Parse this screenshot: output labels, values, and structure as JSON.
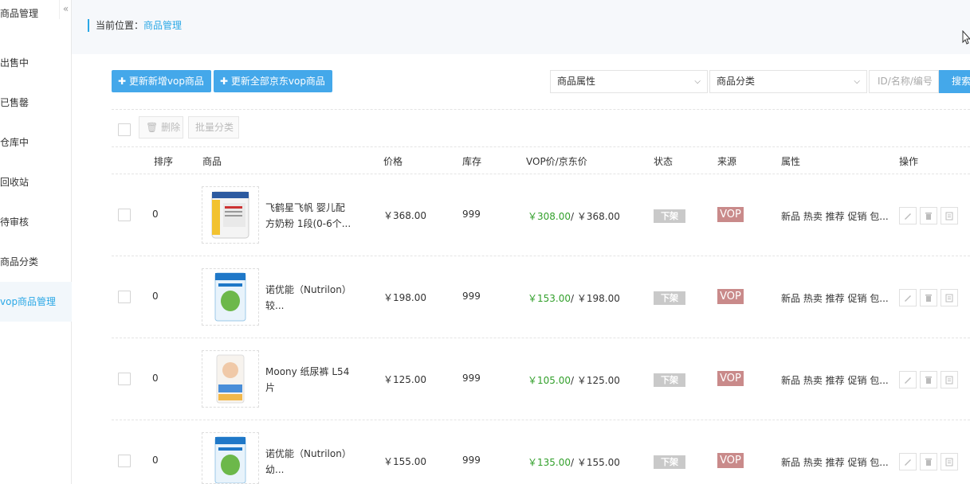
{
  "sidebar": {
    "title": "商品管理",
    "collapse_glyph": "«",
    "items": [
      {
        "label": "出售中"
      },
      {
        "label": "已售罄"
      },
      {
        "label": "仓库中"
      },
      {
        "label": "回收站"
      },
      {
        "label": "待审核"
      },
      {
        "label": "商品分类"
      },
      {
        "label": "vop商品管理"
      }
    ]
  },
  "breadcrumb": {
    "prefix": "当前位置：",
    "current": "商品管理"
  },
  "toolbar": {
    "btn_update_new": "✚ 更新新增vop商品",
    "btn_update_all": "✚ 更新全部京东vop商品",
    "filter_attr": "商品属性",
    "filter_category": "商品分类",
    "search_placeholder": "ID/名称/编号",
    "search_label": "搜索"
  },
  "bulk": {
    "delete_label": "删除",
    "batch_category_label": "批量分类"
  },
  "table": {
    "headers": [
      "排序",
      "商品",
      "价格",
      "库存",
      "VOP价/京东价",
      "状态",
      "来源",
      "属性",
      "操作"
    ],
    "rows": [
      {
        "sort": "0",
        "name": "飞鹤星飞帆 婴儿配方奶粉 1段(0-6个...",
        "price": "￥368.00",
        "stock": "999",
        "vop": "￥308.00",
        "jd": "/ ￥368.00",
        "status": "下架",
        "source": "VOP",
        "attrs": "新品 热卖 推荐 促销 包..."
      },
      {
        "sort": "0",
        "name": "诺优能（Nutrilon）较...",
        "price": "￥198.00",
        "stock": "999",
        "vop": "￥153.00",
        "jd": "/ ￥198.00",
        "status": "下架",
        "source": "VOP",
        "attrs": "新品 热卖 推荐 促销 包..."
      },
      {
        "sort": "0",
        "name": "Moony 纸尿裤 L54片",
        "price": "￥125.00",
        "stock": "999",
        "vop": "￥105.00",
        "jd": "/ ￥125.00",
        "status": "下架",
        "source": "VOP",
        "attrs": "新品 热卖 推荐 促销 包..."
      },
      {
        "sort": "0",
        "name": "诺优能（Nutrilon） 幼...",
        "price": "￥155.00",
        "stock": "999",
        "vop": "￥135.00",
        "jd": "/ ￥155.00",
        "status": "下架",
        "source": "VOP",
        "attrs": "新品 热卖 推荐 促销 包..."
      }
    ]
  },
  "colors": {
    "accent": "#2ba8e6",
    "button": "#44a8ea",
    "vop_price": "#33a02c",
    "vop_badge": "#c98a8a"
  }
}
